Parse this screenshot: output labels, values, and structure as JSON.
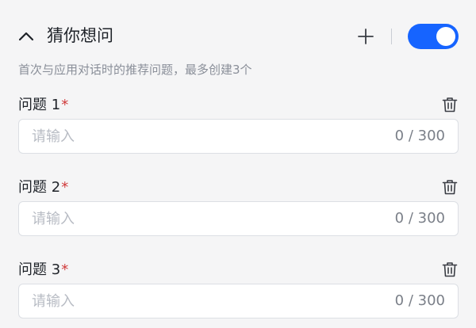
{
  "header": {
    "title": "猜你想问",
    "toggle_on": true,
    "accent_color": "#1664ff"
  },
  "description": "首次与应用对话时的推荐问题，最多创建3个",
  "icons": {
    "collapse": "chevron-up-icon",
    "add": "plus-icon",
    "delete": "trash-icon"
  },
  "questions": [
    {
      "label": "问题 1",
      "required_mark": "*",
      "value": "",
      "placeholder": "请输入",
      "counter": "0 / 300"
    },
    {
      "label": "问题 2",
      "required_mark": "*",
      "value": "",
      "placeholder": "请输入",
      "counter": "0 / 300"
    },
    {
      "label": "问题 3",
      "required_mark": "*",
      "value": "",
      "placeholder": "请输入",
      "counter": "0 / 300"
    }
  ]
}
